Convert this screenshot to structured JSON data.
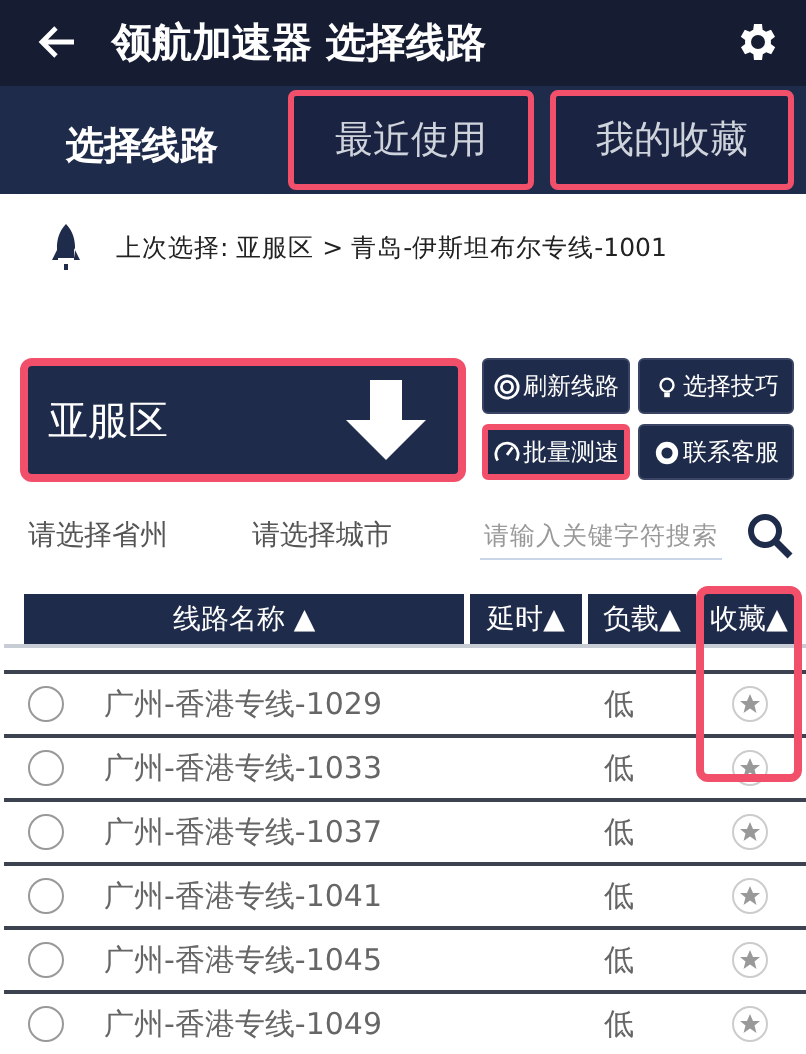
{
  "header": {
    "title": "领航加速器 选择线路"
  },
  "tabs": [
    {
      "label": "选择线路",
      "selected": true,
      "highlighted": false
    },
    {
      "label": "最近使用",
      "selected": false,
      "highlighted": true
    },
    {
      "label": "我的收藏",
      "selected": false,
      "highlighted": true
    }
  ],
  "last_selection": {
    "text": "上次选择: 亚服区 > 青岛-伊斯坦布尔专线-1001"
  },
  "region_select": {
    "value": "亚服区",
    "highlighted": true
  },
  "actions": [
    {
      "label": "刷新线路",
      "kind": "refresh",
      "highlighted": false
    },
    {
      "label": "选择技巧",
      "kind": "tips",
      "highlighted": false
    },
    {
      "label": "批量测速",
      "kind": "speed",
      "highlighted": true
    },
    {
      "label": "联系客服",
      "kind": "service",
      "highlighted": false
    }
  ],
  "filters": {
    "province": {
      "placeholder": "请选择省州"
    },
    "city": {
      "placeholder": "请选择城市"
    },
    "search": {
      "placeholder": "请输入关键字符搜索"
    }
  },
  "table": {
    "columns": [
      {
        "label": "线路名称 ▲",
        "highlighted": false
      },
      {
        "label": "延时▲",
        "highlighted": false
      },
      {
        "label": "负载▲",
        "highlighted": false
      },
      {
        "label": "收藏▲",
        "highlighted": true
      }
    ],
    "rows": [
      {
        "name": "广州-香港专线-1029",
        "load": "低",
        "selected": false,
        "favorite": false
      },
      {
        "name": "广州-香港专线-1033",
        "load": "低",
        "selected": false,
        "favorite": false
      },
      {
        "name": "广州-香港专线-1037",
        "load": "低",
        "selected": false,
        "favorite": false
      },
      {
        "name": "广州-香港专线-1041",
        "load": "低",
        "selected": false,
        "favorite": false
      },
      {
        "name": "广州-香港专线-1045",
        "load": "低",
        "selected": false,
        "favorite": false
      },
      {
        "name": "广州-香港专线-1049",
        "load": "低",
        "selected": false,
        "favorite": false
      }
    ]
  }
}
